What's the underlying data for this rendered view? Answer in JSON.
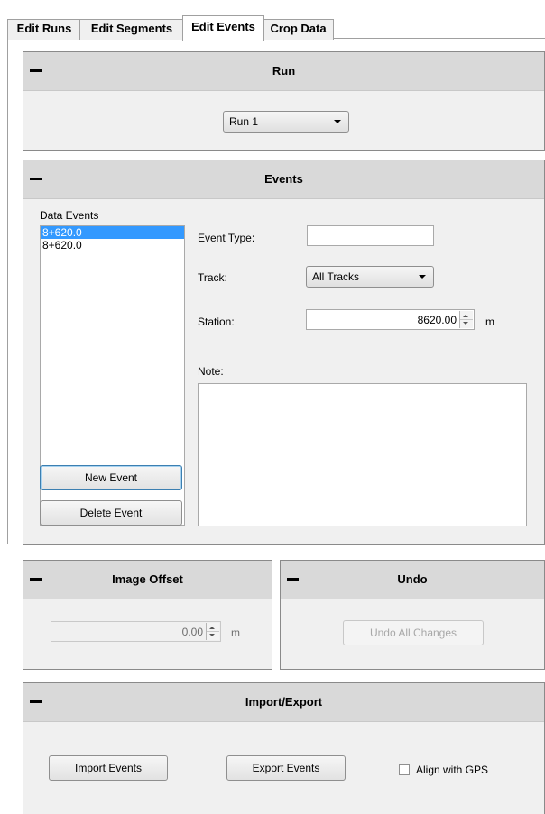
{
  "tabs": [
    {
      "label": "Edit Runs"
    },
    {
      "label": "Edit Segments"
    },
    {
      "label": "Edit Events"
    },
    {
      "label": "Crop Data"
    }
  ],
  "run_panel": {
    "title": "Run",
    "run_select": "Run 1"
  },
  "events_panel": {
    "title": "Events",
    "list_label": "Data Events",
    "events": [
      "8+620.0",
      "8+620.0"
    ],
    "selected_index": 0,
    "event_type_label": "Event Type:",
    "event_type_value": "",
    "track_label": "Track:",
    "track_value": "All Tracks",
    "station_label": "Station:",
    "station_value": "8620.00",
    "station_unit": "m",
    "note_label": "Note:",
    "note_value": "",
    "new_event_label": "New Event",
    "delete_event_label": "Delete Event"
  },
  "image_offset_panel": {
    "title": "Image Offset",
    "value": "0.00",
    "unit": "m"
  },
  "undo_panel": {
    "title": "Undo",
    "undo_all_label": "Undo All Changes"
  },
  "import_export_panel": {
    "title": "Import/Export",
    "import_label": "Import Events",
    "export_label": "Export Events",
    "align_gps_label": "Align with GPS",
    "align_gps_checked": false
  }
}
